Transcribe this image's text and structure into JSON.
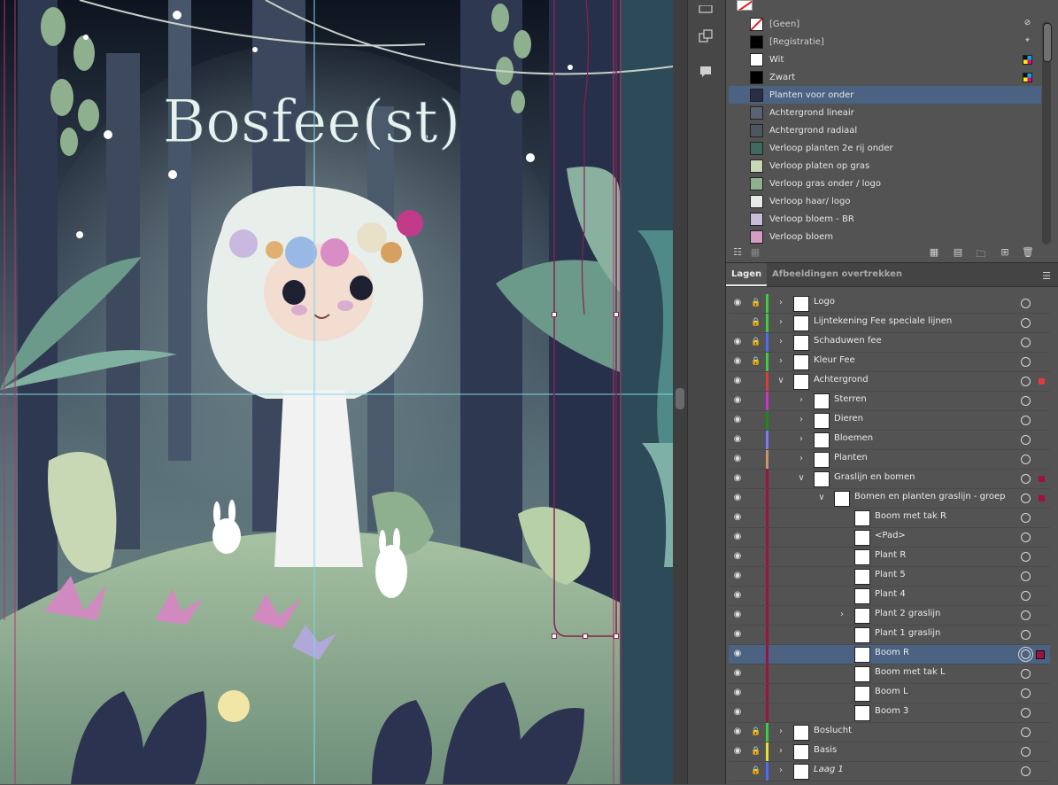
{
  "colors": {
    "canvas_bg": "#1a2230",
    "selection_row": "#4b6282",
    "guide": "#7fd8e8",
    "artboard_edge": "#c0306a"
  },
  "artwork": {
    "title": "Bosfee(st)"
  },
  "toolstrip": {
    "icons": [
      "layers-panel-icon",
      "artboards-icon",
      "comments-icon"
    ]
  },
  "swatches": {
    "items": [
      {
        "name": "[Geen]",
        "color": "none",
        "icon": "no-print-icon"
      },
      {
        "name": "[Registratie]",
        "color": "#000000",
        "icon": "registration-icon"
      },
      {
        "name": "Wit",
        "color": "#ffffff",
        "icon": "cmyk-icon"
      },
      {
        "name": "Zwart",
        "color": "#000000",
        "icon": "cmyk-icon"
      },
      {
        "name": "Planten voor onder",
        "color": "#2a2d45",
        "selected": true
      },
      {
        "name": "Achtergrond lineair",
        "color": "#5a6374"
      },
      {
        "name": "Achtergrond radiaal",
        "color": "#4e5662"
      },
      {
        "name": "Verloop planten 2e rij onder",
        "color": "#3f6a60"
      },
      {
        "name": "Verloop platen op gras",
        "color": "#c9d8b4"
      },
      {
        "name": "Verloop gras onder / logo",
        "color": "#8fb08f"
      },
      {
        "name": "Verloop haar/ logo",
        "color": "#e6ebe6"
      },
      {
        "name": "Verloop bloem - BR",
        "color": "#c8bcd8"
      },
      {
        "name": "Verloop bloem",
        "color": "#d49cc4"
      }
    ],
    "footer_icons": [
      "swatch-libraries-icon",
      "show-kinds-icon",
      "swatch-options-icon",
      "new-color-group-icon",
      "new-swatch-icon",
      "delete-swatch-icon"
    ]
  },
  "layers": {
    "tabs": [
      {
        "label": "Lagen",
        "active": true
      },
      {
        "label": "Afbeeldingen overtrekken",
        "active": false
      }
    ],
    "rows": [
      {
        "name": "Logo",
        "depth": 0,
        "visible": true,
        "locked": true,
        "expand": "collapsed",
        "color": "#3ccf3c"
      },
      {
        "name": "Lijntekening Fee speciale lijnen",
        "depth": 0,
        "visible": false,
        "locked": true,
        "expand": "collapsed",
        "color": "#3ccf3c"
      },
      {
        "name": "Schaduwen fee",
        "depth": 0,
        "visible": true,
        "locked": true,
        "expand": "collapsed",
        "color": "#4a6cff"
      },
      {
        "name": "Kleur Fee",
        "depth": 0,
        "visible": true,
        "locked": true,
        "expand": "collapsed",
        "color": "#3ccf3c"
      },
      {
        "name": "Achtergrond",
        "depth": 0,
        "visible": true,
        "locked": false,
        "expand": "expanded",
        "color": "#e03a3a",
        "marker": "#e03a3a"
      },
      {
        "name": "Sterren",
        "depth": 1,
        "visible": true,
        "expand": "collapsed",
        "color": "#d030d0"
      },
      {
        "name": "Dieren",
        "depth": 1,
        "visible": true,
        "expand": "collapsed",
        "color": "#1a8a1a"
      },
      {
        "name": "Bloemen",
        "depth": 1,
        "visible": true,
        "expand": "collapsed",
        "color": "#7a7aff"
      },
      {
        "name": "Planten",
        "depth": 1,
        "visible": true,
        "expand": "collapsed",
        "color": "#c8946a"
      },
      {
        "name": "Graslijn en bomen",
        "depth": 1,
        "visible": true,
        "expand": "expanded",
        "color": "#a01040",
        "marker": "#a01040"
      },
      {
        "name": "Bomen en planten graslijn - groep",
        "depth": 2,
        "visible": true,
        "expand": "expanded",
        "color": "#a01040",
        "marker": "#a01040"
      },
      {
        "name": "Boom met tak R",
        "depth": 3,
        "visible": true,
        "color": "#a01040"
      },
      {
        "name": "<Pad>",
        "depth": 3,
        "visible": true,
        "color": "#a01040"
      },
      {
        "name": "Plant R",
        "depth": 3,
        "visible": true,
        "color": "#a01040"
      },
      {
        "name": "Plant 5",
        "depth": 3,
        "visible": true,
        "color": "#a01040"
      },
      {
        "name": "Plant 4",
        "depth": 3,
        "visible": true,
        "color": "#a01040"
      },
      {
        "name": "Plant 2 graslijn",
        "depth": 3,
        "visible": true,
        "expand": "collapsed",
        "color": "#a01040"
      },
      {
        "name": "Plant 1 graslijn",
        "depth": 3,
        "visible": true,
        "color": "#a01040"
      },
      {
        "name": "Boom R",
        "depth": 3,
        "visible": true,
        "color": "#a01040",
        "selected": true,
        "marker": "#a01040"
      },
      {
        "name": "Boom met tak L",
        "depth": 3,
        "visible": true,
        "color": "#a01040"
      },
      {
        "name": "Boom L",
        "depth": 3,
        "visible": true,
        "color": "#a01040"
      },
      {
        "name": "Boom 3",
        "depth": 3,
        "visible": true,
        "color": "#a01040"
      },
      {
        "name": "Boslucht",
        "depth": 0,
        "visible": true,
        "locked": true,
        "expand": "collapsed",
        "color": "#3ccf3c"
      },
      {
        "name": "Basis",
        "depth": 0,
        "visible": true,
        "locked": true,
        "expand": "collapsed",
        "color": "#e8e030"
      },
      {
        "name": "Laag 1",
        "depth": 0,
        "visible": false,
        "locked": true,
        "expand": "collapsed",
        "color": "#4a6cff",
        "italic": true
      }
    ]
  }
}
